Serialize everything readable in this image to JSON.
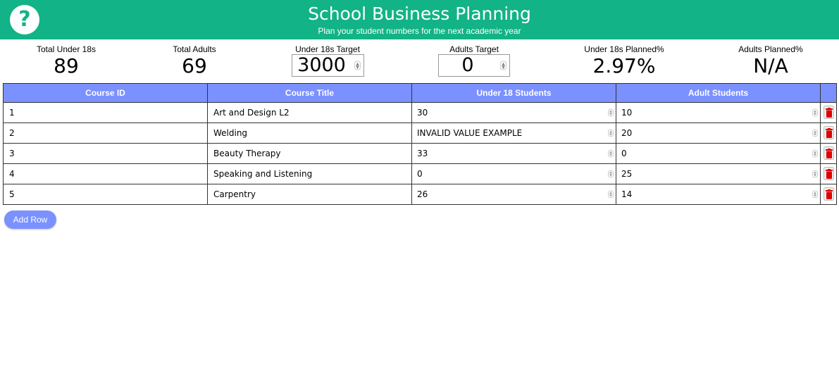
{
  "header": {
    "title": "School Business Planning",
    "subtitle": "Plan your student numbers for the next academic year",
    "help_symbol": "?"
  },
  "stats": {
    "total_under18": {
      "label": "Total Under 18s",
      "value": "89"
    },
    "total_adults": {
      "label": "Total Adults",
      "value": "69"
    },
    "under18_target": {
      "label": "Under 18s Target",
      "value": "3000"
    },
    "adults_target": {
      "label": "Adults Target",
      "value": "0"
    },
    "under18_planned": {
      "label": "Under 18s Planned%",
      "value": "2.97%"
    },
    "adults_planned": {
      "label": "Adults Planned%",
      "value": "N/A"
    }
  },
  "table": {
    "headers": [
      "Course ID",
      "Course Title",
      "Under 18 Students",
      "Adult Students",
      ""
    ],
    "rows": [
      {
        "id": "1",
        "title": "Art and Design L2",
        "under18": "30",
        "adults": "10"
      },
      {
        "id": "2",
        "title": "Welding",
        "under18": "INVALID VALUE EXAMPLE",
        "adults": "20"
      },
      {
        "id": "3",
        "title": "Beauty Therapy",
        "under18": "33",
        "adults": "0"
      },
      {
        "id": "4",
        "title": "Speaking and Listening",
        "under18": "0",
        "adults": "25"
      },
      {
        "id": "5",
        "title": "Carpentry",
        "under18": "26",
        "adults": "14"
      }
    ]
  },
  "actions": {
    "add_row_label": "Add Row"
  },
  "colors": {
    "header_bg": "#12b386",
    "table_header_bg": "#7b91ff",
    "delete_icon": "#e00000"
  },
  "icons": {
    "help": "question-mark-icon",
    "delete": "trash-icon"
  }
}
